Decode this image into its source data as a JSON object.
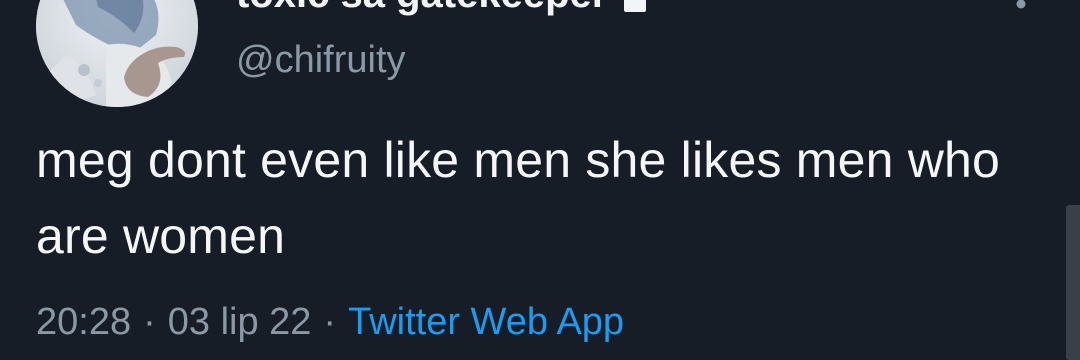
{
  "tweet": {
    "display_name": "toxic sa gatekeeper",
    "handle": "@chifruity",
    "text": "meg dont even like men she likes men who are women",
    "time": "20:28",
    "date": "03 lip 22",
    "separator": "·",
    "source": "Twitter Web App"
  },
  "icons": {
    "protected": "lock-icon",
    "menu": "more-icon"
  },
  "colors": {
    "background": "#161d27",
    "text": "#f5f6f7",
    "secondary": "#8b98a5",
    "link": "#1d9bf0"
  }
}
